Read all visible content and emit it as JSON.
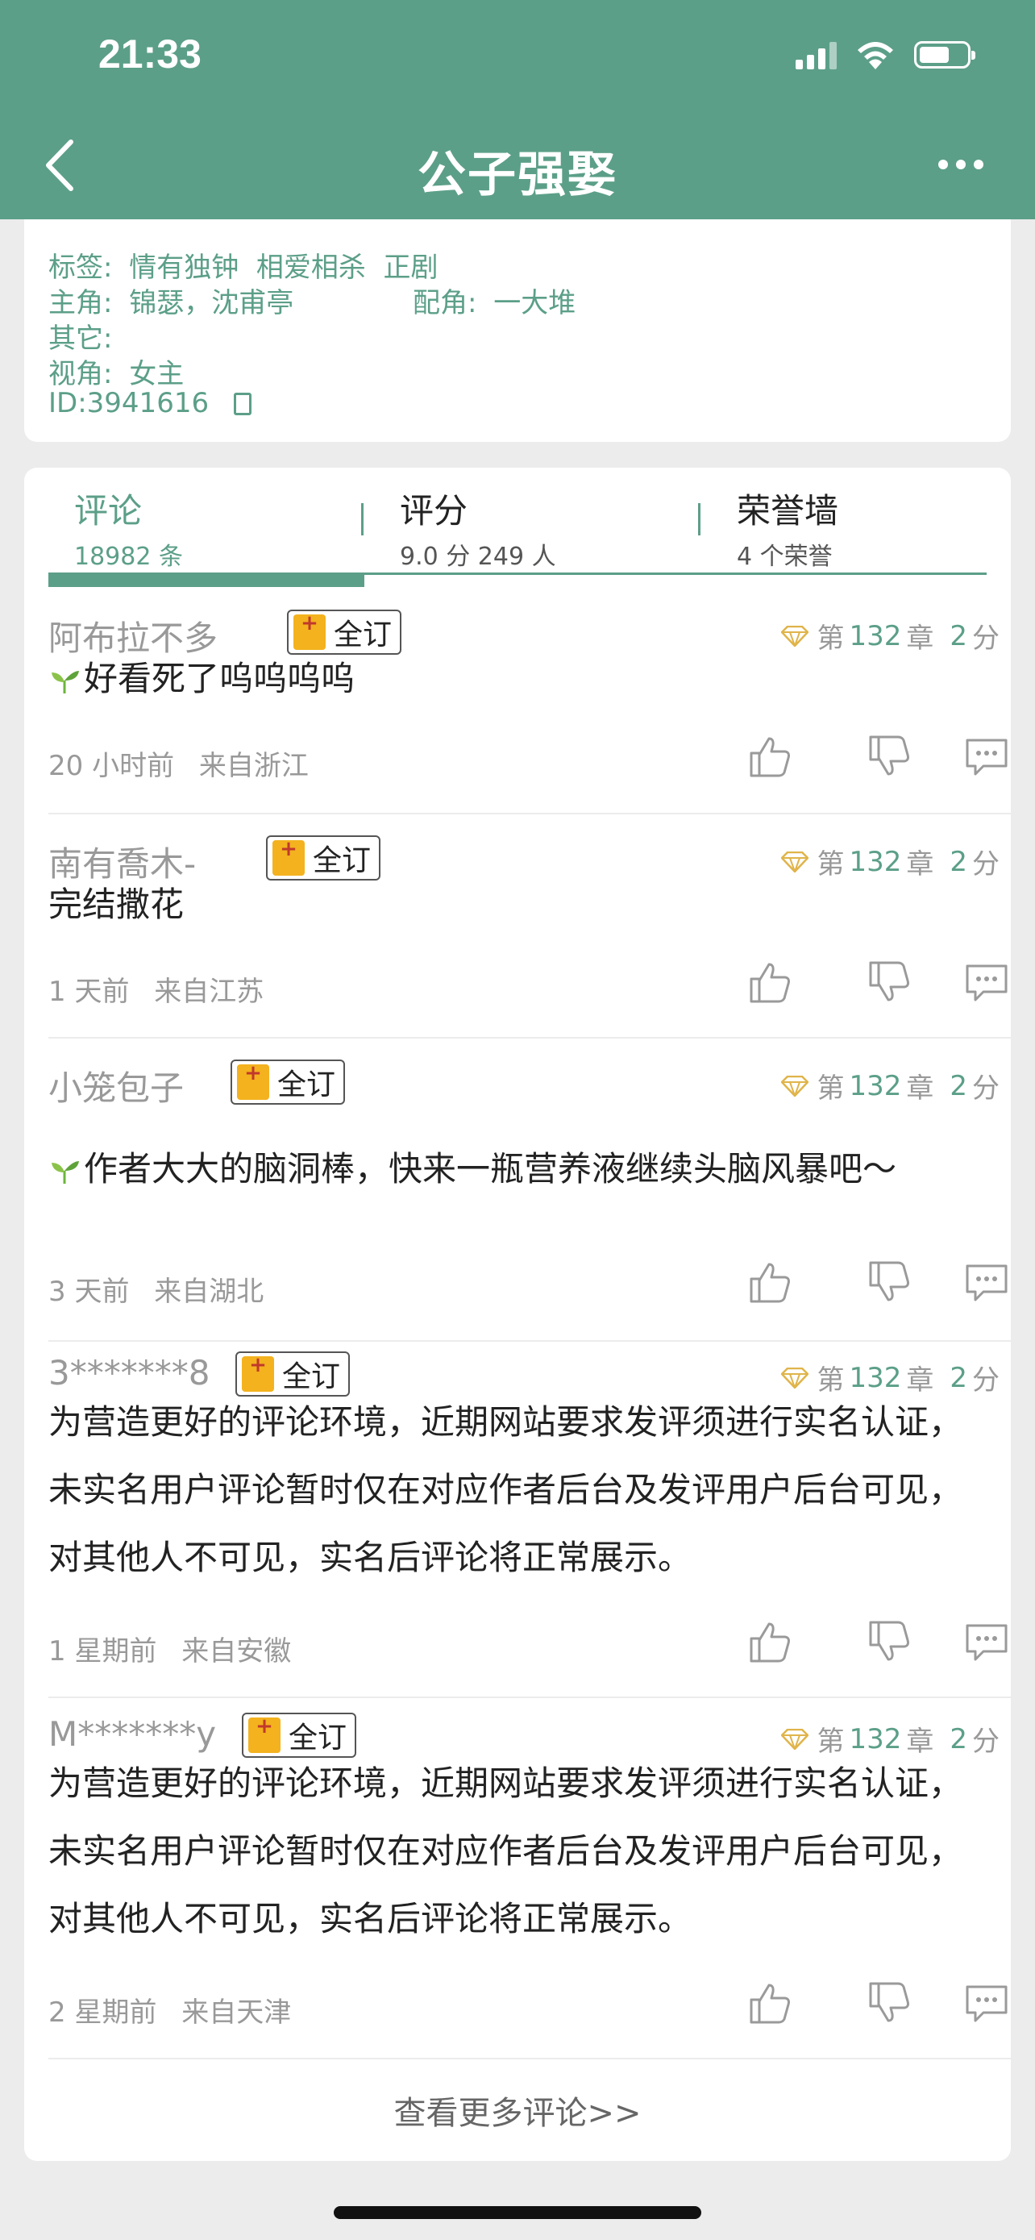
{
  "status_bar": {
    "time": "21:33"
  },
  "nav": {
    "title": "公子强娶"
  },
  "info": {
    "tags_label": "标签:",
    "tags": "情有独钟  相爱相杀  正剧",
    "lead_label": "主角:",
    "lead": "锦瑟，沈甫亭",
    "support_label": "配角:",
    "support": "一大堆",
    "other_label": "其它:",
    "other": "",
    "pov_label": "视角:",
    "pov": "女主",
    "id_text": "ID:3941616"
  },
  "tabs": [
    {
      "label": "评论",
      "sub": "18982 条"
    },
    {
      "label": "评分",
      "sub": "9.0 分 249 人"
    },
    {
      "label": "荣誉墙",
      "sub": "4 个荣誉"
    }
  ],
  "comments": [
    {
      "user": "阿布拉不多",
      "badge": "全订",
      "chapter_pre": "第",
      "chapter": "132",
      "chapter_post": "章",
      "score": "2",
      "score_unit": "分",
      "text": "好看死了呜呜呜呜",
      "time": "20 小时前",
      "location": "来自浙江"
    },
    {
      "user": "南有喬木-",
      "badge": "全订",
      "chapter_pre": "第",
      "chapter": "132",
      "chapter_post": "章",
      "score": "2",
      "score_unit": "分",
      "text": "完结撒花",
      "time": "1 天前",
      "location": "来自江苏"
    },
    {
      "user": "小笼包子",
      "badge": "全订",
      "chapter_pre": "第",
      "chapter": "132",
      "chapter_post": "章",
      "score": "2",
      "score_unit": "分",
      "text": "作者大大的脑洞棒，快来一瓶营养液继续头脑风暴吧～",
      "time": "3 天前",
      "location": "来自湖北"
    },
    {
      "user": "3*******8",
      "badge": "全订",
      "chapter_pre": "第",
      "chapter": "132",
      "chapter_post": "章",
      "score": "2",
      "score_unit": "分",
      "text": "为营造更好的评论环境，近期网站要求发评须进行实名认证，未实名用户评论暂时仅在对应作者后台及发评用户后台可见，对其他人不可见，实名后评论将正常展示。",
      "time": "1 星期前",
      "location": "来自安徽"
    },
    {
      "user": "M*******y",
      "badge": "全订",
      "chapter_pre": "第",
      "chapter": "132",
      "chapter_post": "章",
      "score": "2",
      "score_unit": "分",
      "text": "为营造更好的评论环境，近期网站要求发评须进行实名认证，未实名用户评论暂时仅在对应作者后台及发评用户后台可见，对其他人不可见，实名后评论将正常展示。",
      "time": "2 星期前",
      "location": "来自天津"
    }
  ],
  "load_more": "查看更多评论>>",
  "colors": {
    "accent": "#5c9f88",
    "badge": "#f3b21e"
  }
}
